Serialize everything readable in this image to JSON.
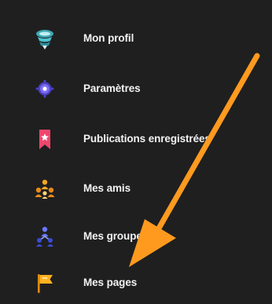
{
  "menu": {
    "items": [
      {
        "label": "Mon profil",
        "icon": "profile-icon"
      },
      {
        "label": "Paramètres",
        "icon": "settings-icon"
      },
      {
        "label": "Publications enregistrées",
        "icon": "bookmark-icon"
      },
      {
        "label": "Mes amis",
        "icon": "friends-icon"
      },
      {
        "label": "Mes groupes",
        "icon": "groups-icon"
      },
      {
        "label": "Mes pages",
        "icon": "pages-flag-icon"
      }
    ]
  },
  "annotation": {
    "icon": "annotation-arrow-icon",
    "color": "#ff9a1f"
  }
}
